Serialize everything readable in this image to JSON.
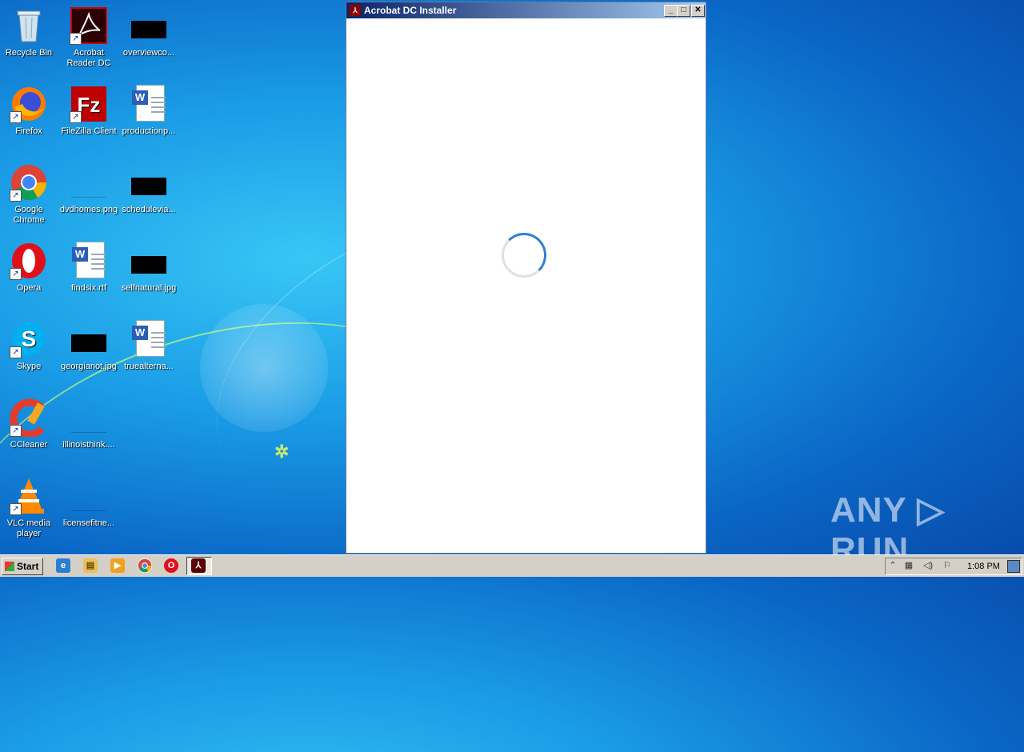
{
  "desktop": {
    "icons": [
      {
        "label": "Recycle Bin"
      },
      {
        "label": "Acrobat Reader DC"
      },
      {
        "label": "overviewco..."
      },
      {
        "label": "Firefox"
      },
      {
        "label": "FileZilla Client"
      },
      {
        "label": "productionp..."
      },
      {
        "label": "Google Chrome"
      },
      {
        "label": "dvdhomes.png"
      },
      {
        "label": "schedulevia..."
      },
      {
        "label": "Opera"
      },
      {
        "label": "findsix.rtf"
      },
      {
        "label": "selfnatural.jpg"
      },
      {
        "label": "Skype"
      },
      {
        "label": "georgianot.jpg"
      },
      {
        "label": "truealterna..."
      },
      {
        "label": "CCleaner"
      },
      {
        "label": "illinoisthink...."
      },
      {
        "label": "VLC media player"
      },
      {
        "label": "licensefitne..."
      }
    ]
  },
  "window": {
    "title": "Acrobat DC Installer",
    "minimize_symbol": "_",
    "maximize_symbol": "□",
    "close_symbol": "✕"
  },
  "watermark": {
    "text": "ANY ▷ RUN"
  },
  "taskbar": {
    "start_label": "Start",
    "clock": "1:08 PM",
    "pinned": [
      "internet-explorer-icon",
      "explorer-icon",
      "media-player-icon",
      "chrome-icon",
      "opera-icon",
      "acrobat-icon"
    ]
  },
  "colors": {
    "spinner": "#2f7fd6",
    "titlebar_start": "#0a246a",
    "titlebar_end": "#a6caf0",
    "taskbar": "#d4d0c8"
  }
}
